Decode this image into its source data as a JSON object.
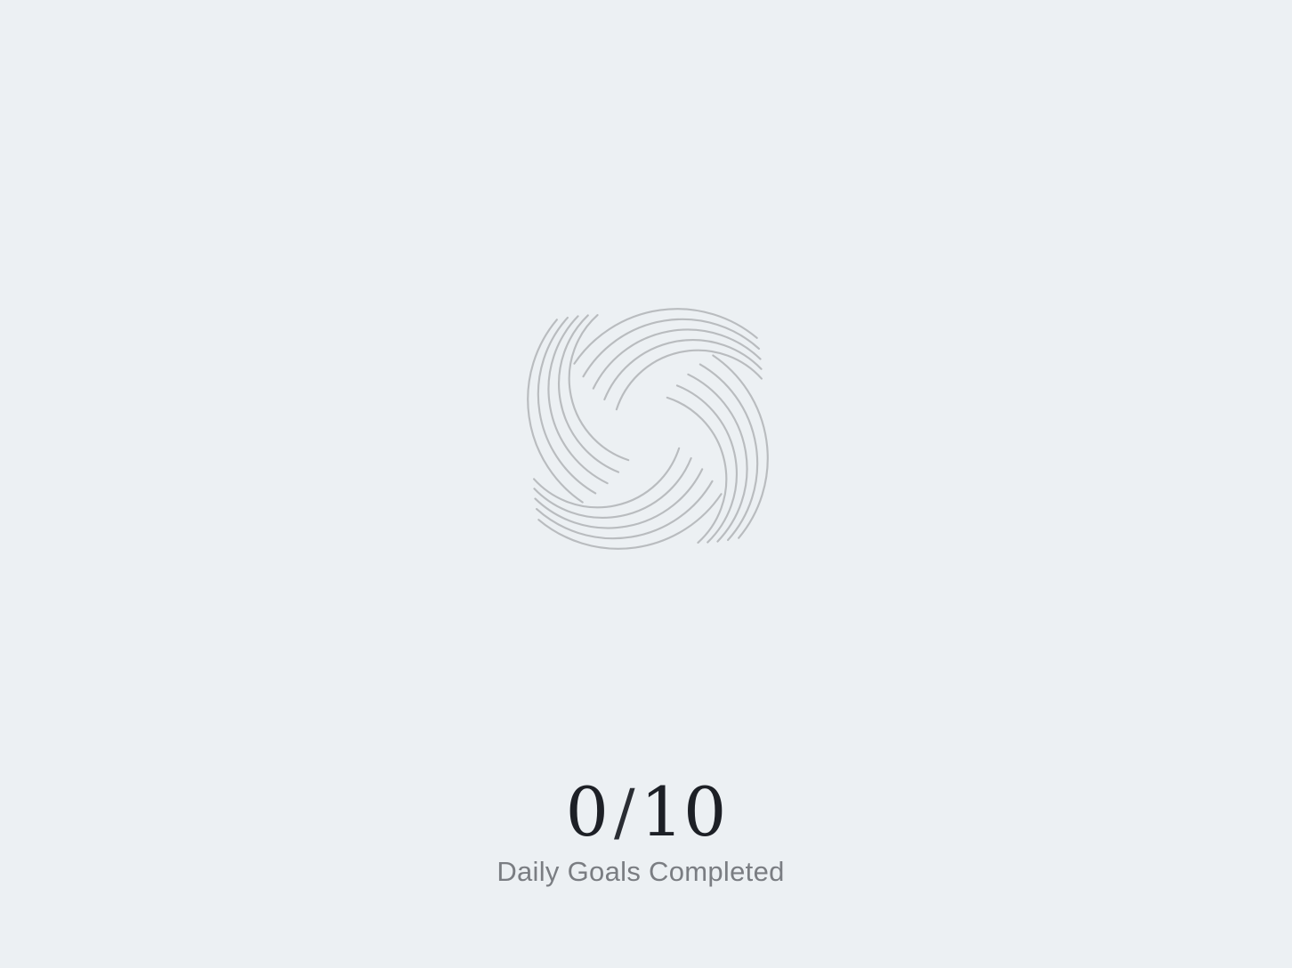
{
  "progress": {
    "completed": "0",
    "separator": "/",
    "total": "10",
    "label": "Daily Goals Completed",
    "fraction": 0
  },
  "icon": "swirl-ring-icon",
  "colors": {
    "background": "#ecf0f3",
    "swirl_stroke": "#b9bcbf",
    "counter_text": "#1d2026",
    "label_text": "#7a7d82"
  }
}
